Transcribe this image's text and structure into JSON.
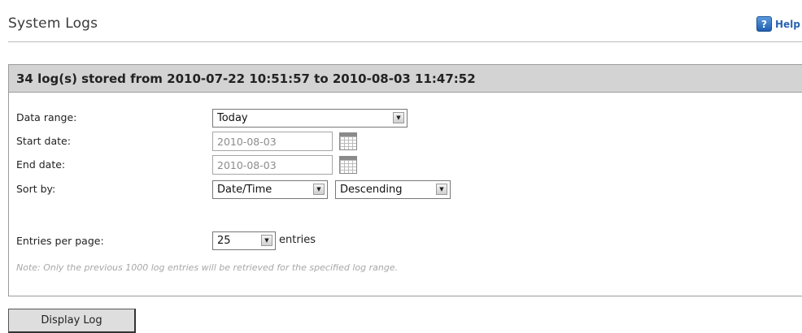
{
  "page": {
    "title": "System Logs",
    "help_label": "Help",
    "help_glyph": "?"
  },
  "panel": {
    "header": "34 log(s) stored from 2010-07-22 10:51:57 to 2010-08-03 11:47:52",
    "fields": {
      "data_range": {
        "label": "Data range:",
        "value": "Today"
      },
      "start_date": {
        "label": "Start date:",
        "value": "2010-08-03"
      },
      "end_date": {
        "label": "End date:",
        "value": "2010-08-03"
      },
      "sort_by": {
        "label": "Sort by:",
        "field_value": "Date/Time",
        "order_value": "Descending"
      },
      "entries_per_page": {
        "label": "Entries per page:",
        "value": "25",
        "suffix": "entries"
      }
    },
    "note": "Note: Only the previous 1000 log entries will be retrieved for the specified log range."
  },
  "actions": {
    "display_log": "Display Log"
  },
  "icons": {
    "dropdown_arrow": "▼",
    "calendar": "calendar-icon",
    "help": "help-icon"
  },
  "colors": {
    "header_bg": "#d3d3d3",
    "help_link": "#2a63b0",
    "note_text": "#a7a7a7"
  }
}
